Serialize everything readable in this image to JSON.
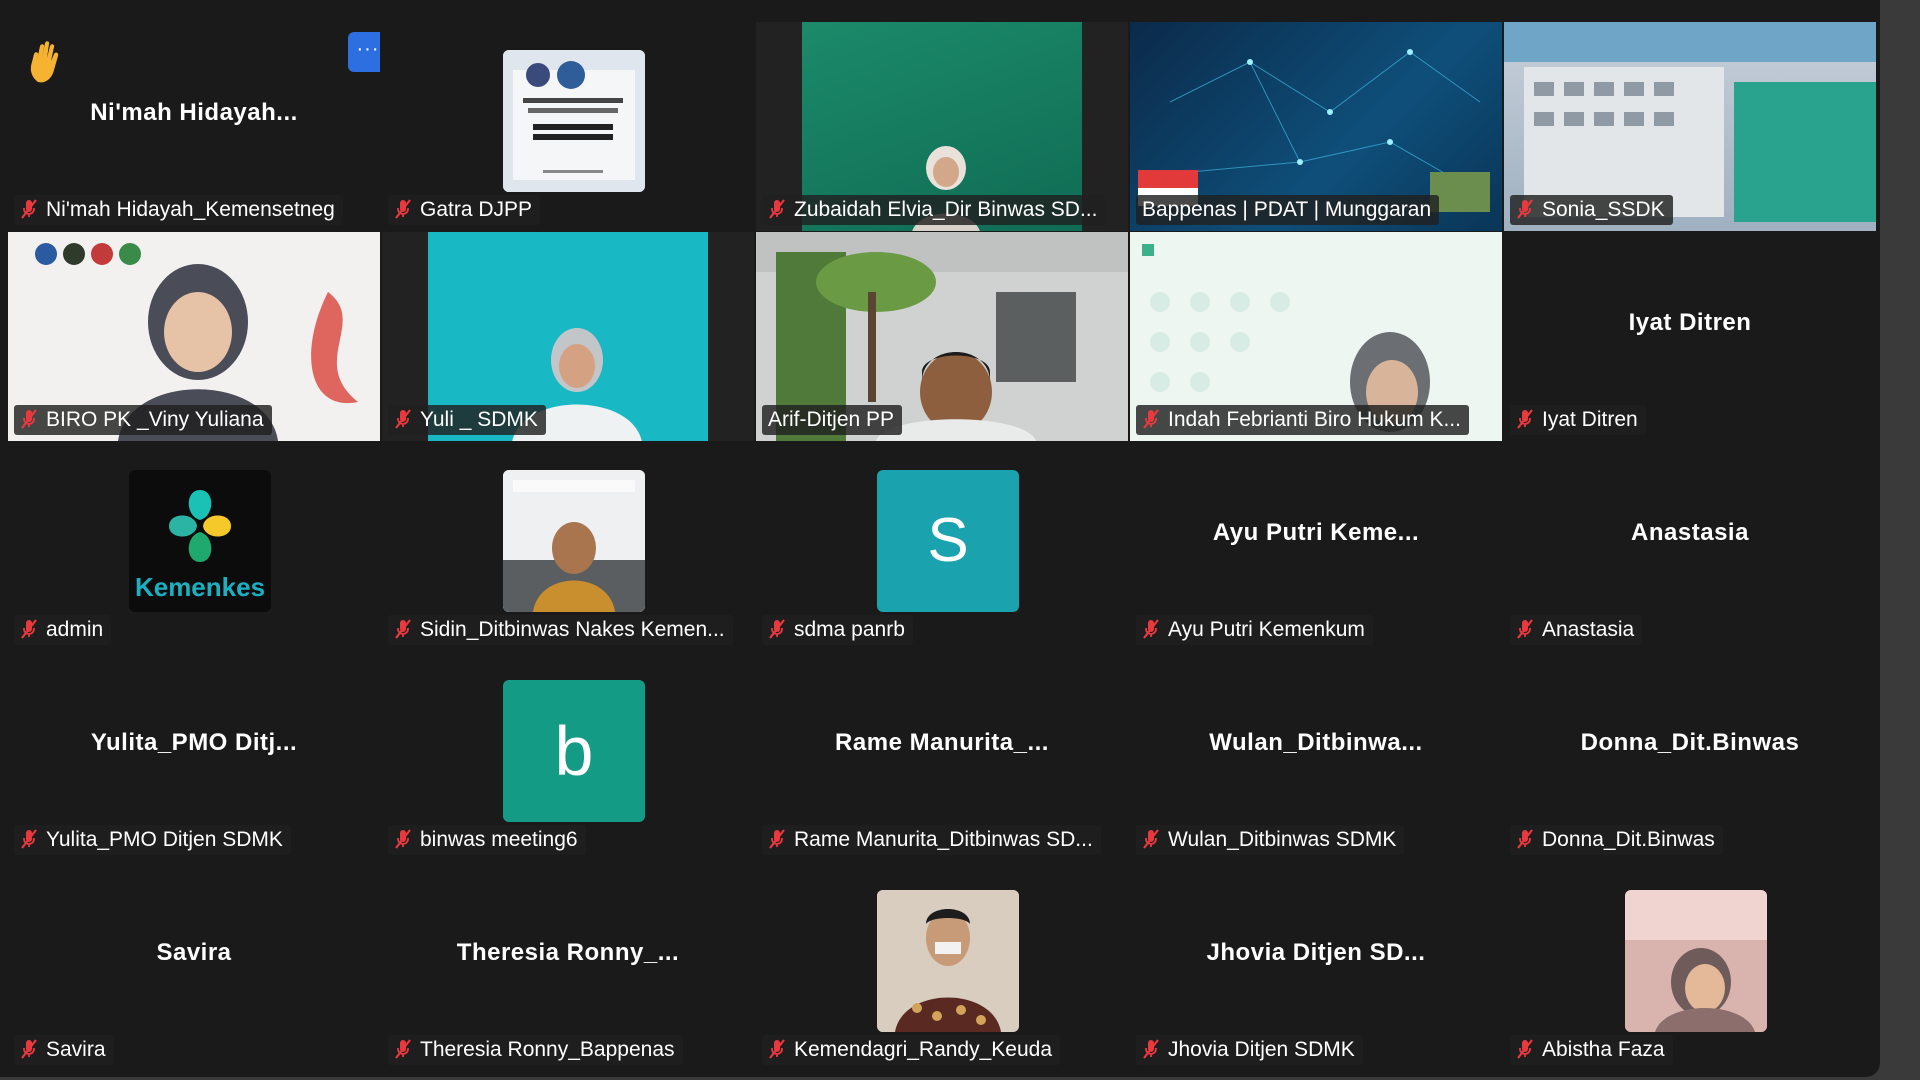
{
  "tiles": [
    {
      "label": "Ni'mah Hidayah_Kemensetneg",
      "display_name": "Ni'mah  Hidayah...",
      "raised_hand": true
    },
    {
      "label": "Gatra DJPP",
      "thumb": "djpp-logo"
    },
    {
      "label": "Zubaidah Elvia_Dir Binwas SD..."
    },
    {
      "label": "Bappenas | PDAT | Munggaran"
    },
    {
      "label": "Sonia_SSDK"
    },
    {
      "label": "BIRO PK _Viny Yuliana"
    },
    {
      "label": "Yuli _ SDMK"
    },
    {
      "label": "Arif-Ditjen PP",
      "active_speaker": true
    },
    {
      "label": "Indah Febrianti Biro Hukum K..."
    },
    {
      "label": "Iyat Ditren",
      "display_name": "Iyat Ditren"
    },
    {
      "label": "admin",
      "thumb": "kemenkes-logo",
      "thumb_text": "Kemenkes"
    },
    {
      "label": "Sidin_Ditbinwas Nakes Kemen..."
    },
    {
      "label": "sdma panrb",
      "thumb": "letter-avatar",
      "avatar_letter": "S"
    },
    {
      "label": "Ayu Putri Kemenkum",
      "display_name": "Ayu  Putri  Keme..."
    },
    {
      "label": "Anastasia",
      "display_name": "Anastasia"
    },
    {
      "label": "Yulita_PMO Ditjen SDMK",
      "display_name": "Yulita_PMO  Ditj..."
    },
    {
      "label": "binwas meeting6",
      "thumb": "letter-avatar",
      "avatar_letter": "b"
    },
    {
      "label": "Rame Manurita_Ditbinwas SD...",
      "display_name": "Rame  Manurita_..."
    },
    {
      "label": "Wulan_Ditbinwas SDMK",
      "display_name": "Wulan_Ditbinwa..."
    },
    {
      "label": "Donna_Dit.Binwas",
      "display_name": "Donna_Dit.Binwas"
    },
    {
      "label": "Savira",
      "display_name": "Savira"
    },
    {
      "label": "Theresia Ronny_Bappenas",
      "display_name": "Theresia  Ronny_..."
    },
    {
      "label": "Kemendagri_Randy_Keuda"
    },
    {
      "label": "Jhovia Ditjen SDMK",
      "display_name": "Jhovia  Ditjen  SD..."
    },
    {
      "label": "Abistha Faza"
    }
  ],
  "more_button": "···",
  "colors": {
    "accent_active": "#23d96a",
    "more_button": "#2d6fe0",
    "avatar_teal": "#1aa3ae",
    "avatar_green": "#149b86",
    "mic_muted": "#e8393f"
  }
}
